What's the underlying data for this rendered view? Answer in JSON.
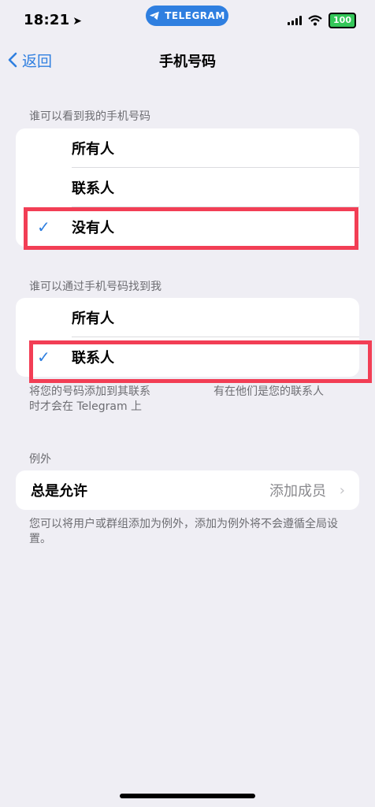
{
  "status_bar": {
    "time": "18:21",
    "telegram_pill": "TELEGRAM",
    "battery": "100"
  },
  "nav": {
    "back_label": "返回",
    "title": "手机号码"
  },
  "sections": [
    {
      "header": "谁可以看到我的手机号码",
      "options": [
        "所有人",
        "联系人",
        "没有人"
      ],
      "selected": "没有人"
    },
    {
      "header": "谁可以通过手机号码找到我",
      "options": [
        "所有人",
        "联系人"
      ],
      "selected": "联系人",
      "footer_line1": "将您的号码添加到其联系",
      "footer_line1_end": "有在他们是您的联系人",
      "footer_line2": "时才会在 Telegram 上"
    },
    {
      "header": "例外",
      "row_label": "总是允许",
      "row_value": "添加成员",
      "footer": "您可以将用户或群组添加为例外，添加为例外将不会遵循全局设置。"
    }
  ],
  "colors": {
    "accent": "#2F7FE0",
    "highlight": "#F23E55",
    "background": "#EFEEF4"
  },
  "icons": [
    "location-arrow-icon",
    "telegram-plane-icon",
    "signal-icon",
    "wifi-icon",
    "battery-icon",
    "back-chevron-icon",
    "checkmark-icon",
    "chevron-right-icon"
  ]
}
